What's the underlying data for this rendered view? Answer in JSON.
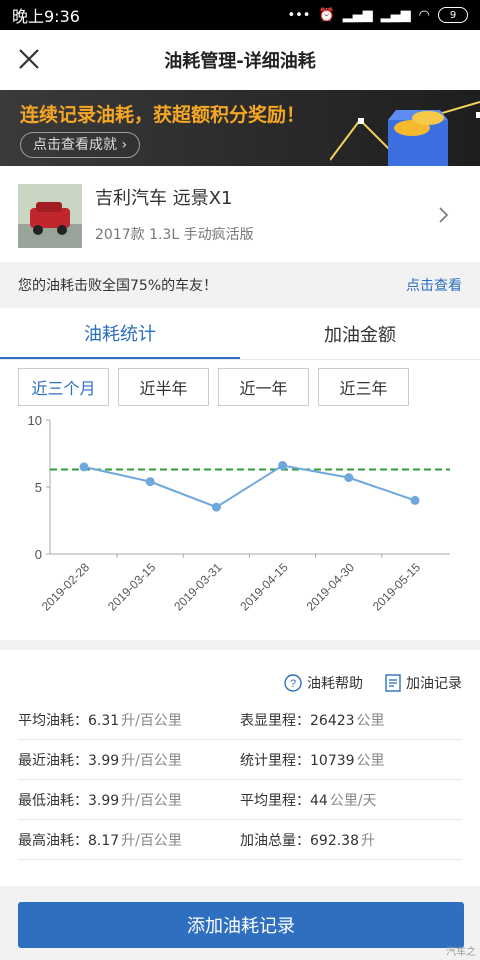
{
  "status": {
    "time": "晚上9:36",
    "battery": "9"
  },
  "header": {
    "title": "油耗管理-详细油耗"
  },
  "banner": {
    "slogan": "连续记录油耗，获超额积分奖励！",
    "button": "点击查看成就"
  },
  "car": {
    "name": "吉利汽车 远景X1",
    "spec": "2017款 1.3L 手动疯活版"
  },
  "rank": {
    "text": "您的油耗击败全国75%的车友！",
    "link": "点击查看"
  },
  "tabs": [
    {
      "label": "油耗统计",
      "active": true
    },
    {
      "label": "加油金额",
      "active": false
    }
  ],
  "ranges": [
    {
      "label": "近三个月",
      "active": true
    },
    {
      "label": "近半年"
    },
    {
      "label": "近一年"
    },
    {
      "label": "近三年"
    }
  ],
  "chart_data": {
    "type": "line",
    "x": [
      "2019-02-28",
      "2019-03-15",
      "2019-03-31",
      "2019-04-15",
      "2019-04-30",
      "2019-05-15"
    ],
    "values": [
      6.5,
      5.4,
      3.5,
      6.6,
      5.7,
      4.0
    ],
    "reference_line": 6.31,
    "ylim": [
      0,
      10
    ],
    "yticks": [
      0,
      5,
      10
    ],
    "colors": {
      "line": "#6fa8dc",
      "reference": "#2e9e3e"
    }
  },
  "links": {
    "help": "油耗帮助",
    "records": "加油记录"
  },
  "stats": [
    [
      {
        "label": "平均油耗：",
        "value": "6.31",
        "unit": "升/百公里"
      },
      {
        "label": "表显里程：",
        "value": "26423",
        "unit": "公里"
      }
    ],
    [
      {
        "label": "最近油耗：",
        "value": "3.99",
        "unit": "升/百公里"
      },
      {
        "label": "统计里程：",
        "value": "10739",
        "unit": "公里"
      }
    ],
    [
      {
        "label": "最低油耗：",
        "value": "3.99",
        "unit": "升/百公里"
      },
      {
        "label": "平均里程：",
        "value": "44",
        "unit": "公里/天"
      }
    ],
    [
      {
        "label": "最高油耗：",
        "value": "8.17",
        "unit": "升/百公里"
      },
      {
        "label": "加油总量：",
        "value": "692.38",
        "unit": "升"
      }
    ]
  ],
  "add_button": "添加油耗记录",
  "watermark": "汽车之"
}
